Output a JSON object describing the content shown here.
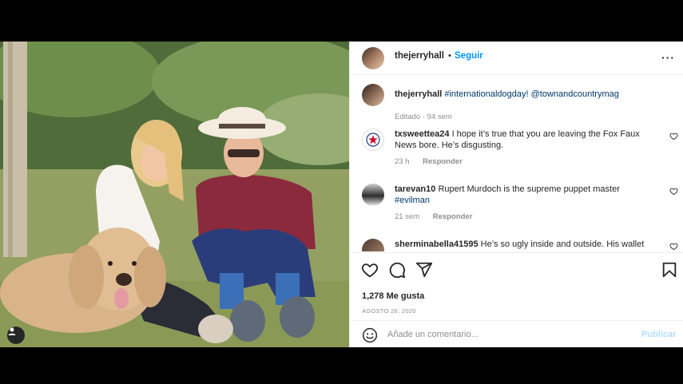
{
  "post": {
    "username": "thejerryhall",
    "separator": "•",
    "follow_label": "Seguir",
    "more_label": "···",
    "caption": {
      "username": "thejerryhall",
      "hashtag": "#internationaldogday!",
      "mention": "@townandcountrymag",
      "edited": "Editado · 94 sem"
    },
    "comments": [
      {
        "username": "txsweettea24",
        "text": "I hope it’s true that you are leaving the Fox Faux News bore. He’s disgusting.",
        "time": "23 h",
        "reply_label": "Responder"
      },
      {
        "username": "tarevan10",
        "text": "Rupert Murdoch is the supreme puppet master",
        "hashtag": "#evilman",
        "time": "21 sem",
        "reply_label": "Responder"
      },
      {
        "username": "sherminabella41595",
        "text": "He’s so ugly inside and outside. His wallet"
      }
    ],
    "likes": "1,278 Me gusta",
    "date": "AGOSTO 26, 2020",
    "comment_placeholder": "Añade un comentario...",
    "publish_label": "Publicar"
  },
  "icons": {
    "heart": "heart-icon",
    "comment": "comment-icon",
    "share": "share-icon",
    "save": "bookmark-icon",
    "emoji": "emoji-icon",
    "user_tag": "user-tag-icon"
  },
  "colors": {
    "accent": "#0095f6",
    "publish_disabled": "#b2dffc",
    "link": "#00376b",
    "muted": "#8e8e8e"
  }
}
